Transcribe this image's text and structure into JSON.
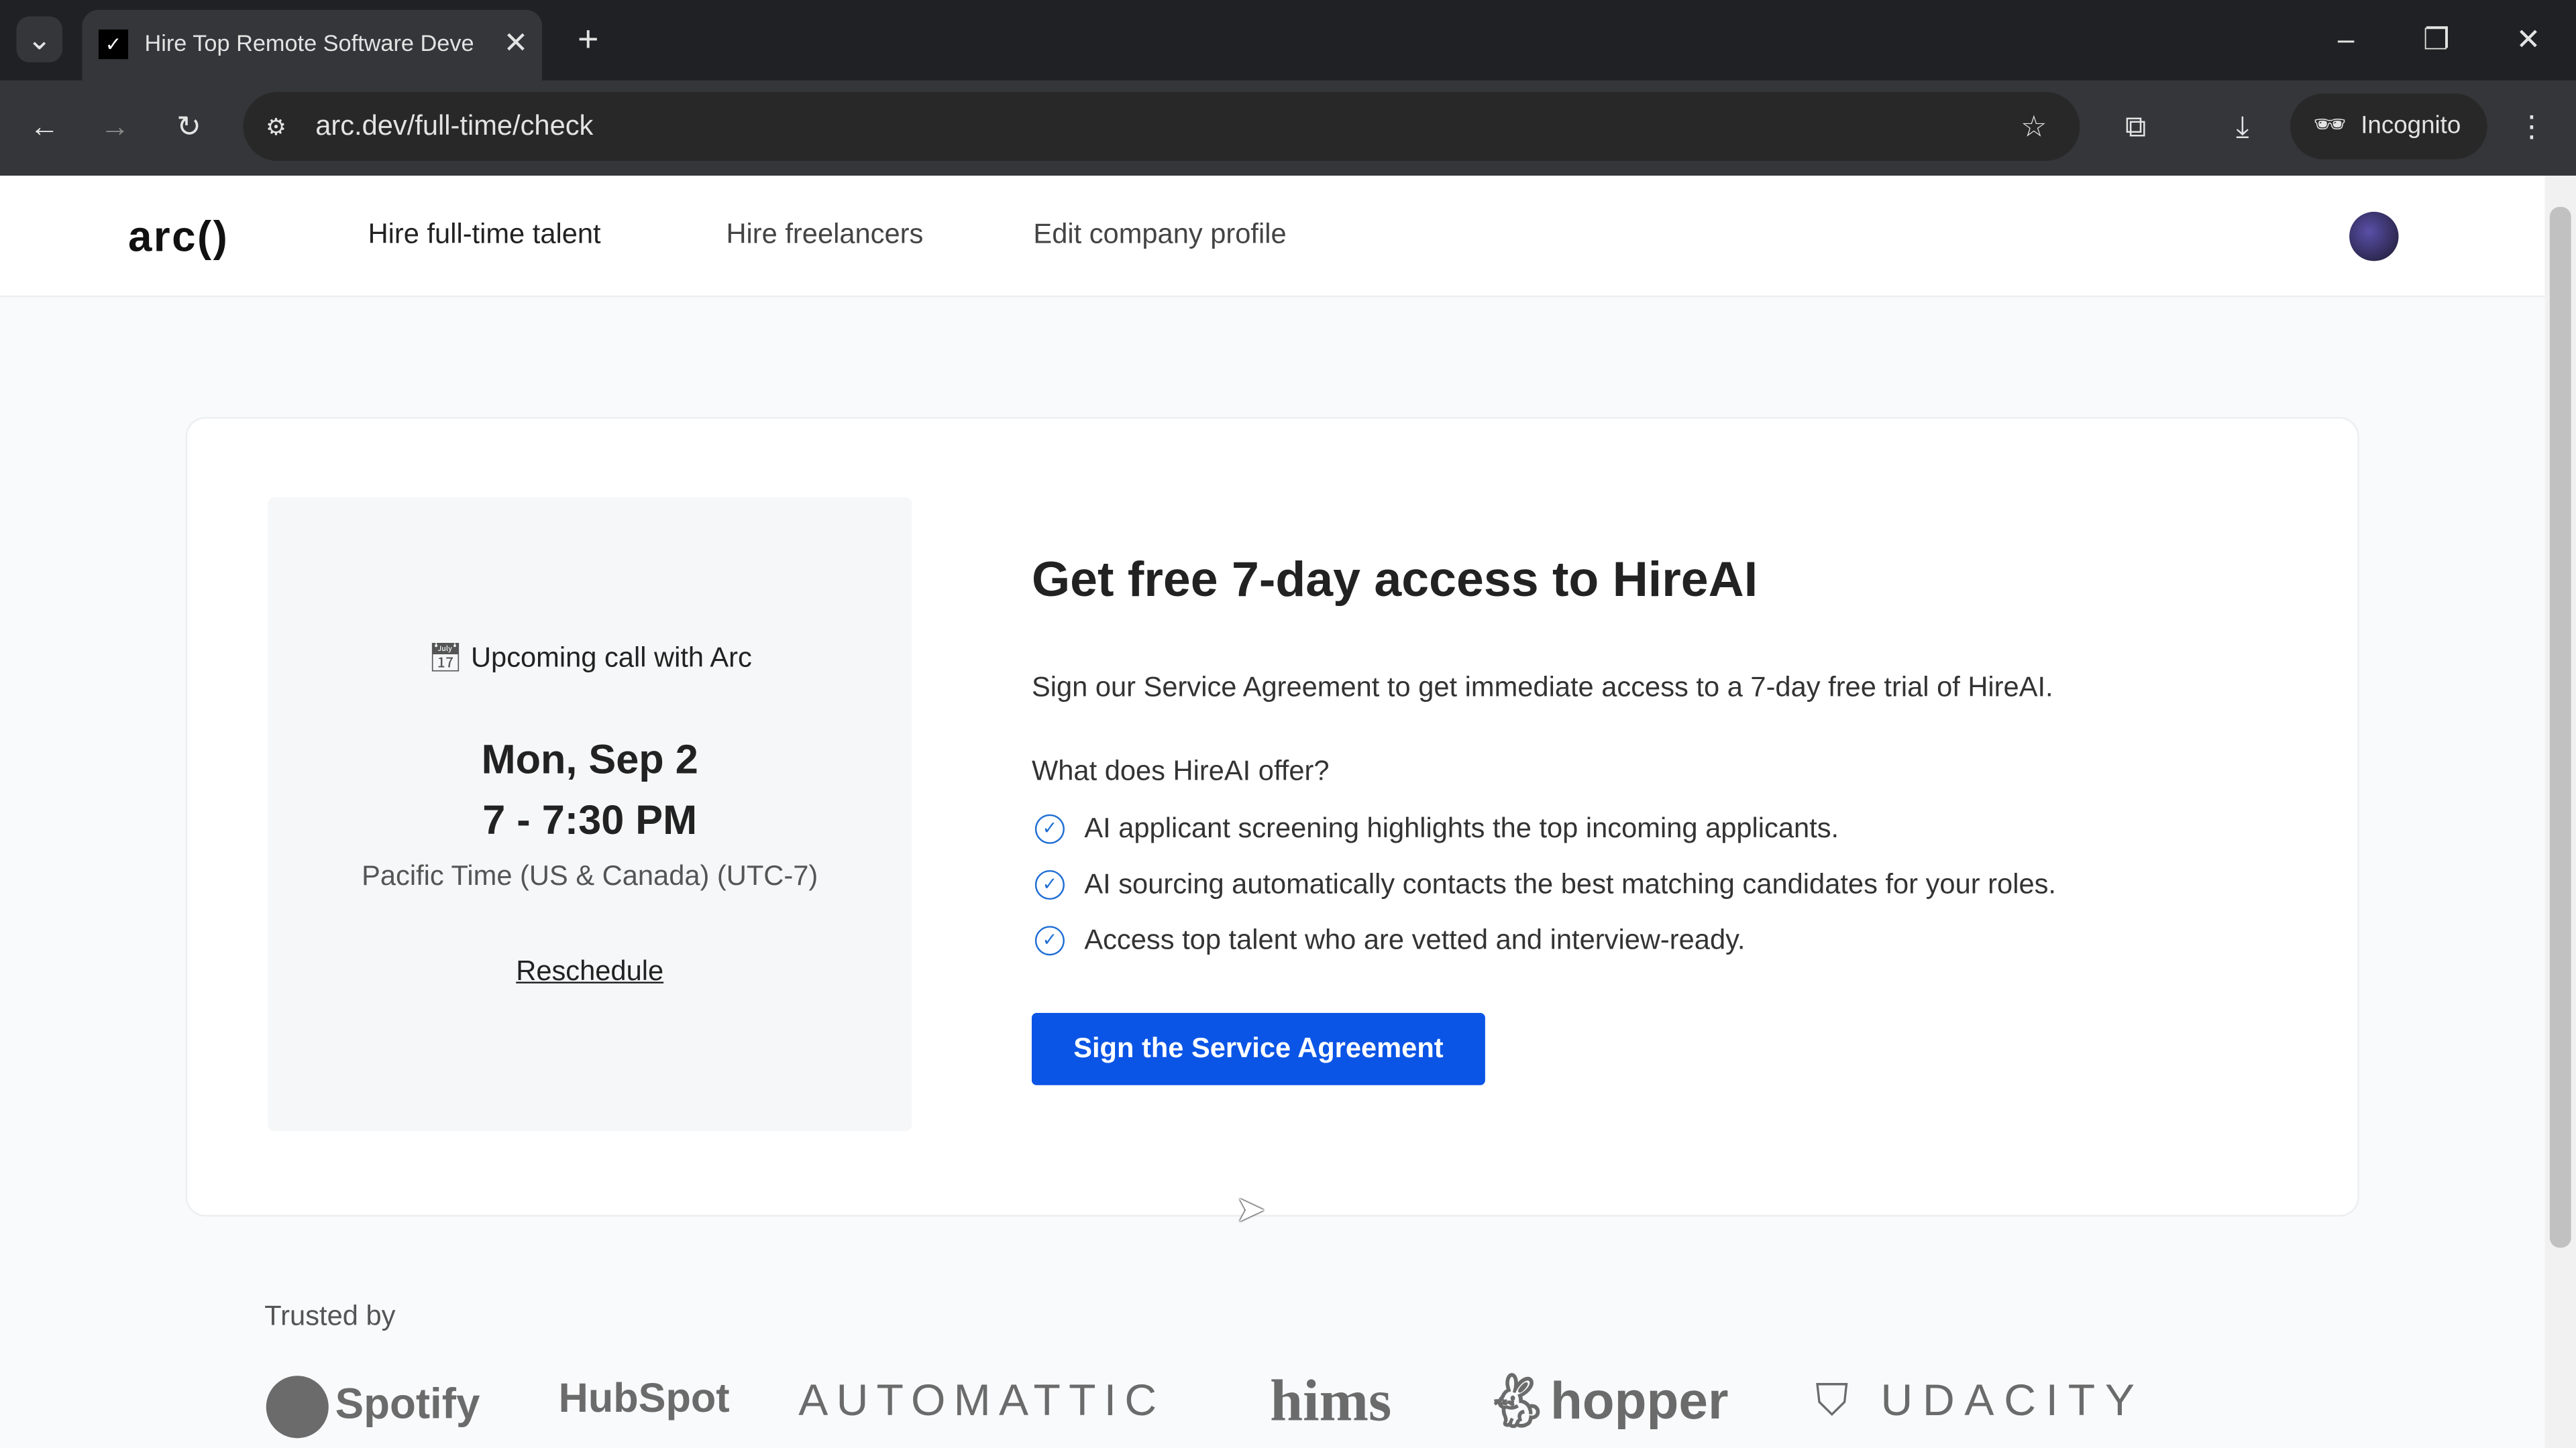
{
  "browser": {
    "tab_title": "Hire Top Remote Software Deve",
    "url": "arc.dev/full-time/check",
    "incognito_label": "Incognito"
  },
  "nav": {
    "logo": "arc()",
    "links": [
      "Hire full-time talent",
      "Hire freelancers",
      "Edit company profile"
    ]
  },
  "call": {
    "heading": "Upcoming call with Arc",
    "date": "Mon, Sep 2",
    "time": "7 - 7:30 PM",
    "timezone": "Pacific Time (US & Canada) (UTC-7)",
    "reschedule": "Reschedule"
  },
  "offer": {
    "title": "Get free 7-day access to HireAI",
    "description": "Sign our Service Agreement to get immediate access to a 7-day free trial of HireAI.",
    "question": "What does HireAI offer?",
    "features": [
      "AI applicant screening highlights the top incoming applicants.",
      "AI sourcing automatically contacts the best matching candidates for your roles.",
      "Access top talent who are vetted and interview-ready."
    ],
    "cta": "Sign the Service Agreement"
  },
  "trusted": {
    "label": "Trusted by",
    "logos": [
      "Spotify",
      "HubSpot",
      "AUTOMATTIC",
      "hims",
      "hopper",
      "UDACITY"
    ]
  },
  "colors": {
    "accent": "#0b55e6",
    "check": "#1f6ed4"
  }
}
